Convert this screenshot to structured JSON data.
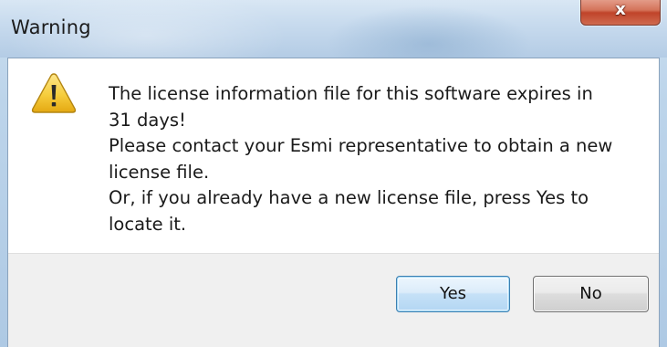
{
  "window": {
    "title": "Warning",
    "close_label": "x"
  },
  "dialog": {
    "icon": "warning-icon",
    "message_lines": [
      "The license information file for this software expires in",
      "31 days!",
      "Please contact your Esmi representative to obtain a new",
      "license file.",
      "Or, if you already have a new license file, press Yes to",
      "locate it."
    ]
  },
  "buttons": {
    "yes_label": "Yes",
    "no_label": "No",
    "default": "Yes"
  },
  "colors": {
    "warning_triangle": "#f2c230",
    "close_button": "#c0442a",
    "default_button_border": "#3c7fb1"
  }
}
